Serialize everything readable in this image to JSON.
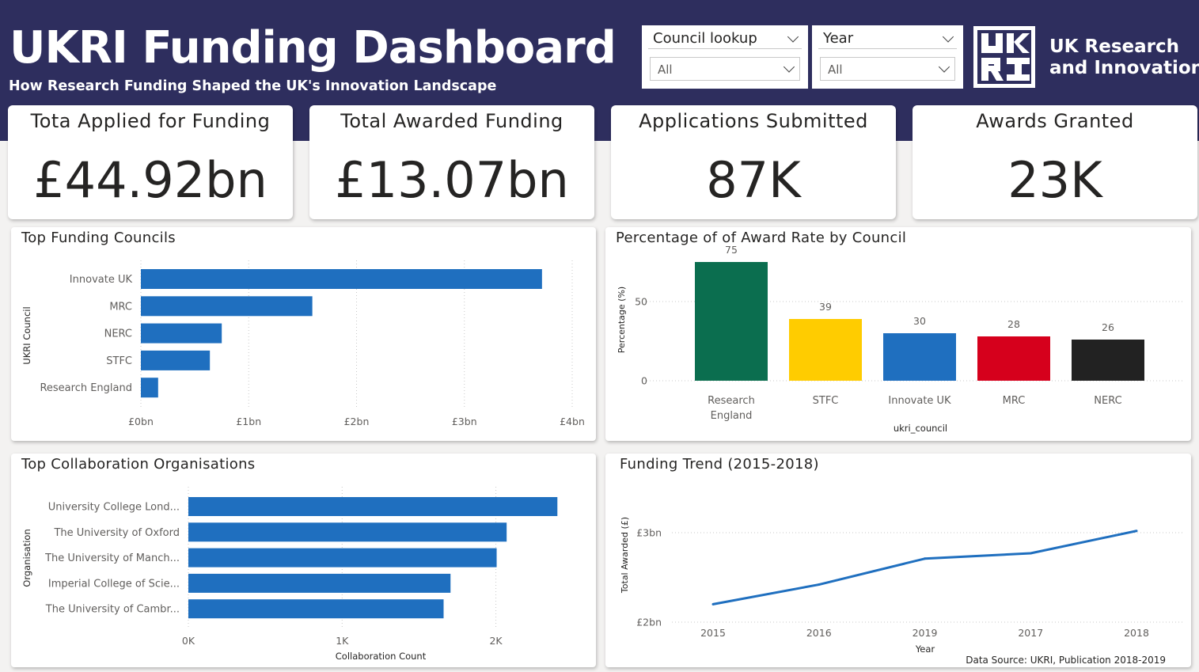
{
  "header": {
    "title": "UKRI Funding Dashboard",
    "subtitle": "How Research Funding Shaped the UK's Innovation Landscape"
  },
  "slicers": {
    "council": {
      "label": "Council lookup",
      "value": "All"
    },
    "year": {
      "label": "Year",
      "value": "All"
    }
  },
  "logo": {
    "line1": "UK Research",
    "line2": "and Innovation"
  },
  "kpis": [
    {
      "label": "Tota Applied for Funding",
      "value": "£44.92bn"
    },
    {
      "label": "Total Awarded Funding",
      "value": "£13.07bn"
    },
    {
      "label": "Applications Submitted",
      "value": "87K"
    },
    {
      "label": "Awards Granted",
      "value": "23K"
    }
  ],
  "colors": {
    "header_bg": "#2e2e5e",
    "bar_blue": "#1f6fbf",
    "research_england": "#0b6e4f",
    "stfc": "#ffcc00",
    "innovate_uk": "#1f6fbf",
    "mrc": "#d6001c",
    "nerc": "#222222"
  },
  "chart_data": [
    {
      "type": "bar",
      "orientation": "horizontal",
      "title": "Top Funding Councils",
      "ylabel": "UKRI Council",
      "xlabel": "",
      "categories": [
        "Innovate UK",
        "MRC",
        "NERC",
        "STFC",
        "Research England"
      ],
      "values": [
        3.72,
        1.59,
        0.75,
        0.64,
        0.16
      ],
      "unit": "£bn",
      "xlim": [
        0,
        4
      ],
      "ticks": [
        "£0bn",
        "£1bn",
        "£2bn",
        "£3bn",
        "£4bn"
      ],
      "tick_values": [
        0,
        1,
        2,
        3,
        4
      ],
      "grid": true
    },
    {
      "type": "bar",
      "title": "Percentage of of Award Rate by Council",
      "ylabel": "Percentage (%)",
      "xlabel": "ukri_council",
      "categories": [
        "Research England",
        "STFC",
        "Innovate UK",
        "MRC",
        "NERC"
      ],
      "category_lines": [
        [
          "Research",
          "England"
        ],
        [
          "STFC"
        ],
        [
          "Innovate UK"
        ],
        [
          "MRC"
        ],
        [
          "NERC"
        ]
      ],
      "values": [
        75,
        39,
        30,
        28,
        26
      ],
      "data_labels": [
        "75",
        "39",
        "30",
        "28",
        "26"
      ],
      "color_keys": [
        "research_england",
        "stfc",
        "innovate_uk",
        "mrc",
        "nerc"
      ],
      "ylim": [
        0,
        80
      ],
      "ticks": [
        "0",
        "50"
      ],
      "tick_values": [
        0,
        50
      ],
      "grid": true
    },
    {
      "type": "bar",
      "orientation": "horizontal",
      "title": "Top Collaboration Organisations",
      "ylabel": "Organisation",
      "xlabel": "Collaboration Count",
      "categories": [
        "University College Lond...",
        "The University of Oxford",
        "The University of Manch...",
        "Imperial College of Scie...",
        "The University of Cambr..."
      ],
      "values": [
        2400,
        2070,
        2005,
        1705,
        1660
      ],
      "xlim": [
        0,
        2450
      ],
      "ticks": [
        "0K",
        "1K",
        "2K"
      ],
      "tick_values": [
        0,
        1000,
        2000
      ],
      "grid": true
    },
    {
      "type": "line",
      "title": "Funding Trend (2015-2018)",
      "ylabel": "Total Awarded (£)",
      "xlabel": "Year",
      "x": [
        "2015",
        "2016",
        "2019",
        "2017",
        "2018"
      ],
      "y": [
        2.2,
        2.42,
        2.71,
        2.77,
        3.02
      ],
      "unit": "£bn",
      "ylim": [
        2,
        3.1
      ],
      "ticks": [
        "£2bn",
        "£3bn"
      ],
      "tick_values": [
        2,
        3
      ],
      "grid": true
    }
  ],
  "footer": {
    "source": "Data Source: UKRI, Publication 2018-2019"
  }
}
